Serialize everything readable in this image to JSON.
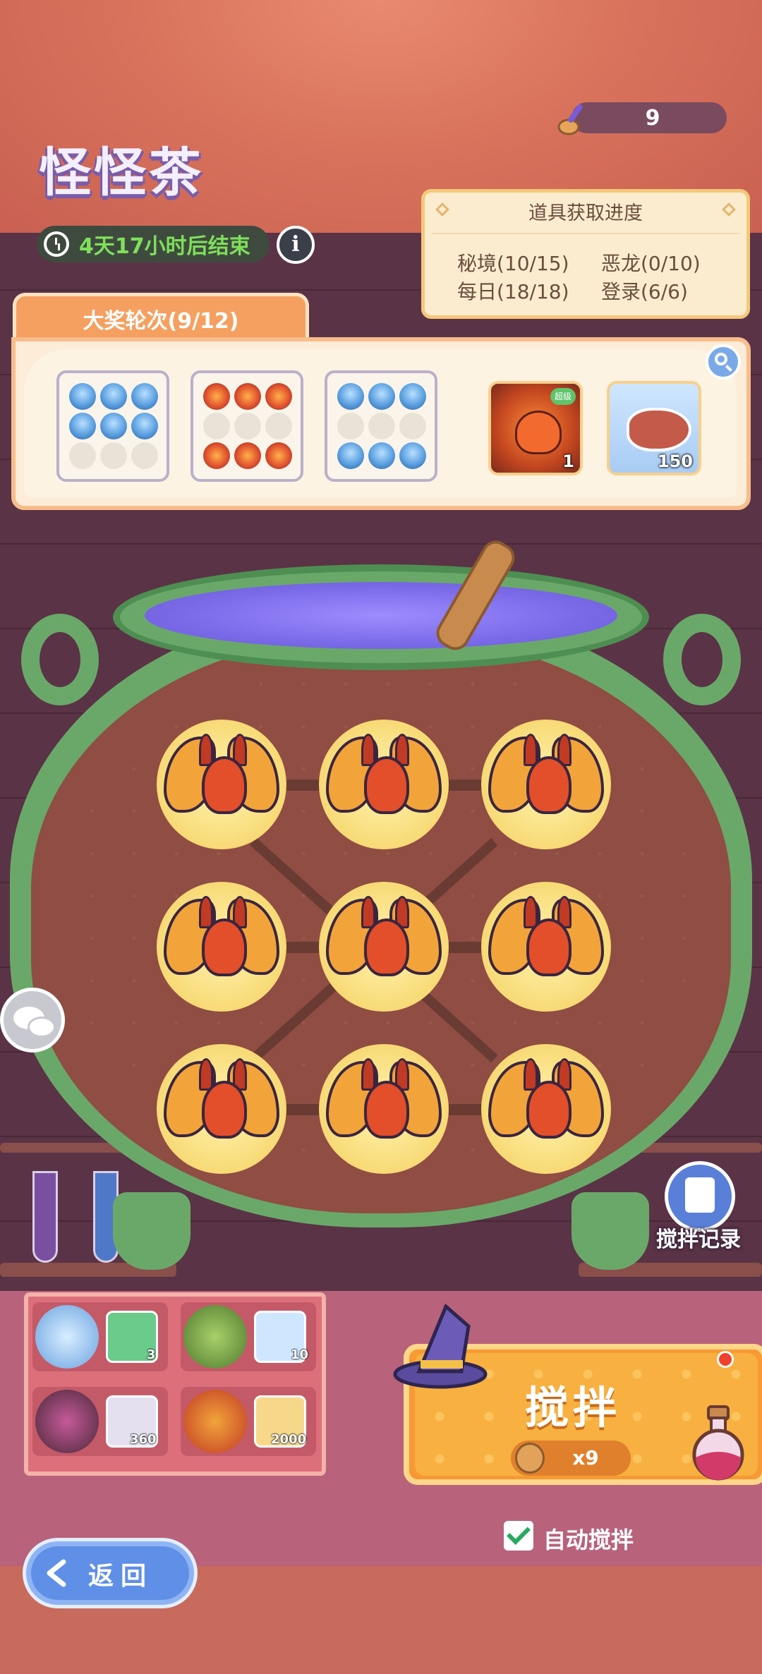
{
  "header": {
    "title": "怪怪茶",
    "timer_text": "4天17小时后结束",
    "currency_value": "9",
    "currency_icon": "spoon-icon"
  },
  "progress_panel": {
    "title": "道具获取进度",
    "items": [
      {
        "label": "秘境(10/15)"
      },
      {
        "label": "恶龙(0/10)"
      },
      {
        "label": "每日(18/18)"
      },
      {
        "label": "登录(6/6)"
      }
    ]
  },
  "prize_panel": {
    "tab_label": "大奖轮次(9/12)",
    "rewards": [
      {
        "name": "fire-slime-egg-icon",
        "badge": "超级",
        "qty": "1"
      },
      {
        "name": "meat-item-icon",
        "qty": "150"
      }
    ]
  },
  "stir_record_label": "搅拌记录",
  "bottom_rewards": [
    {
      "monster": "ice-monster-icon",
      "item": "green-slime-item-icon",
      "qty": "3"
    },
    {
      "monster": "green-beetle-icon",
      "item": "blue-crystal-icon",
      "qty": "10"
    },
    {
      "monster": "dark-flower-monster-icon",
      "item": "iron-ingot-icon",
      "qty": "360"
    },
    {
      "monster": "fire-moth-icon",
      "item": "gold-coin-icon",
      "qty": "2000"
    }
  ],
  "stir_button": {
    "label": "搅拌",
    "cost": "x9"
  },
  "auto_stir": {
    "label": "自动搅拌",
    "checked": true
  },
  "back_button": {
    "label": "返回"
  },
  "colors": {
    "accent_orange": "#f79a33",
    "cauldron_green": "#6aa86a",
    "timer_green": "#7ee05a"
  }
}
